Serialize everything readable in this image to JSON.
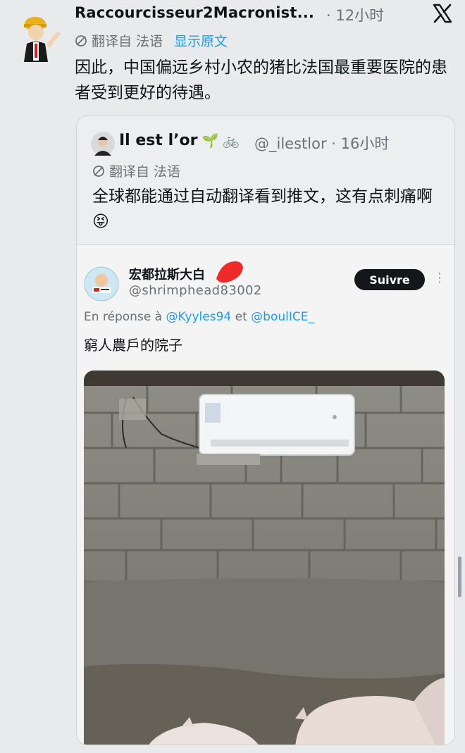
{
  "tweet": {
    "author_name": "Raccourcisseur2Macronist...",
    "time": "· 12小时",
    "translated_from": "翻译自 法语",
    "show_original": "显示原文",
    "text": "因此，中国偏远乡村小农的猪比法国最重要医院的患者受到更好的待遇。"
  },
  "quote": {
    "author_name": "Il est l’or",
    "emoji": "🌱 🚲",
    "handle": "@_ilestlor · 16小时",
    "translated_from": "翻译自 法语",
    "text": "全球都能通过自动翻译看到推文，这有点刺痛啊 😝"
  },
  "inner_tweet": {
    "author_name": "宏都拉斯大白",
    "handle": "@shrimphead83002",
    "follow_label": "Suivre",
    "reply_prefix": "En réponse à",
    "reply_mention_1": "@Kyyles94",
    "reply_and": "et",
    "reply_mention_2": "@boulICE_",
    "text": "窮人農戶的院子"
  },
  "icons": {
    "x_logo": "x-logo-icon",
    "translate": "translate-icon",
    "more": "more-dots-icon"
  },
  "colors": {
    "link": "#1d9bf0",
    "muted": "#6b7177",
    "follow_bg": "#14171a"
  }
}
